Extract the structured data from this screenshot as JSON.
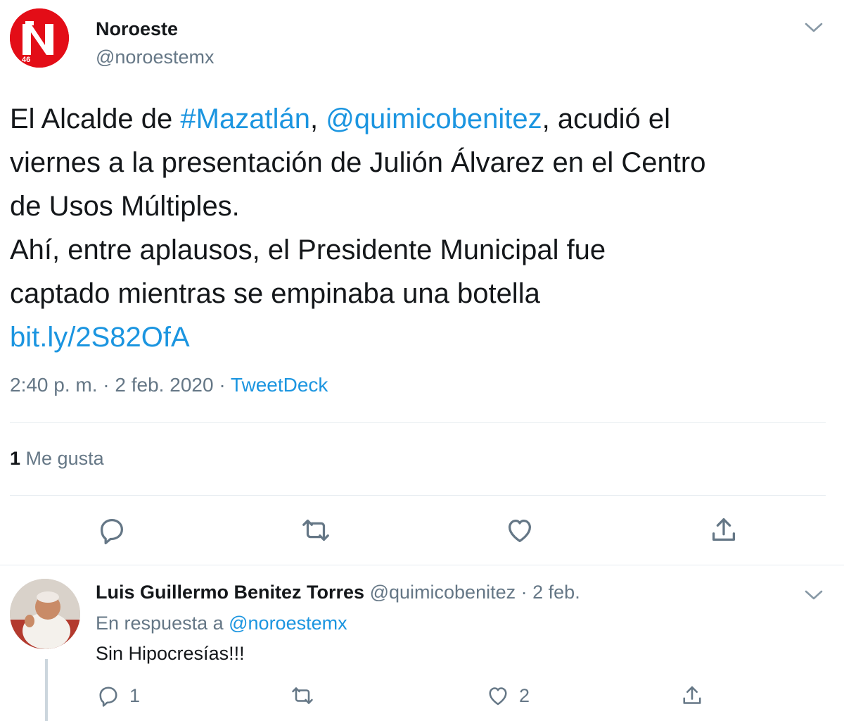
{
  "main_tweet": {
    "author": {
      "name": "Noroeste",
      "handle": "@noroestemx",
      "avatar_logo_text": "46"
    },
    "text_segments": {
      "line1_a": "El Alcalde de ",
      "hashtag": "#Mazatlán",
      "line1_b": ", ",
      "mention": "@quimicobenitez",
      "line1_c": ", acudió el",
      "line2": "viernes a la presentación de Julión Álvarez en el Centro",
      "line3": "de Usos Múltiples.",
      "line4": "Ahí, entre aplausos, el Presidente Municipal fue",
      "line5": "captado mientras se empinaba una botella",
      "link": "bit.ly/2S82OfA"
    },
    "time": "2:40 p. m.",
    "date": "2 feb. 2020",
    "separator": "·",
    "source": "TweetDeck",
    "likes_count": "1",
    "likes_label": "Me gusta",
    "icons": [
      "reply-icon",
      "retweet-icon",
      "like-icon",
      "share-icon"
    ]
  },
  "reply_tweet": {
    "name": "Luis Guillermo Benitez Torres",
    "handle": "@quimicobenitez",
    "separator": "·",
    "date": "2 feb.",
    "in_reply_prefix": "En respuesta a ",
    "in_reply_handle": "@noroestemx",
    "text": "Sin Hipocresías!!!",
    "reply_count": "1",
    "like_count": "2"
  },
  "colors": {
    "brand_red": "#e30d17",
    "link_blue": "#1b95e0",
    "muted_gray": "#657786",
    "divider": "#e6ecf0"
  }
}
